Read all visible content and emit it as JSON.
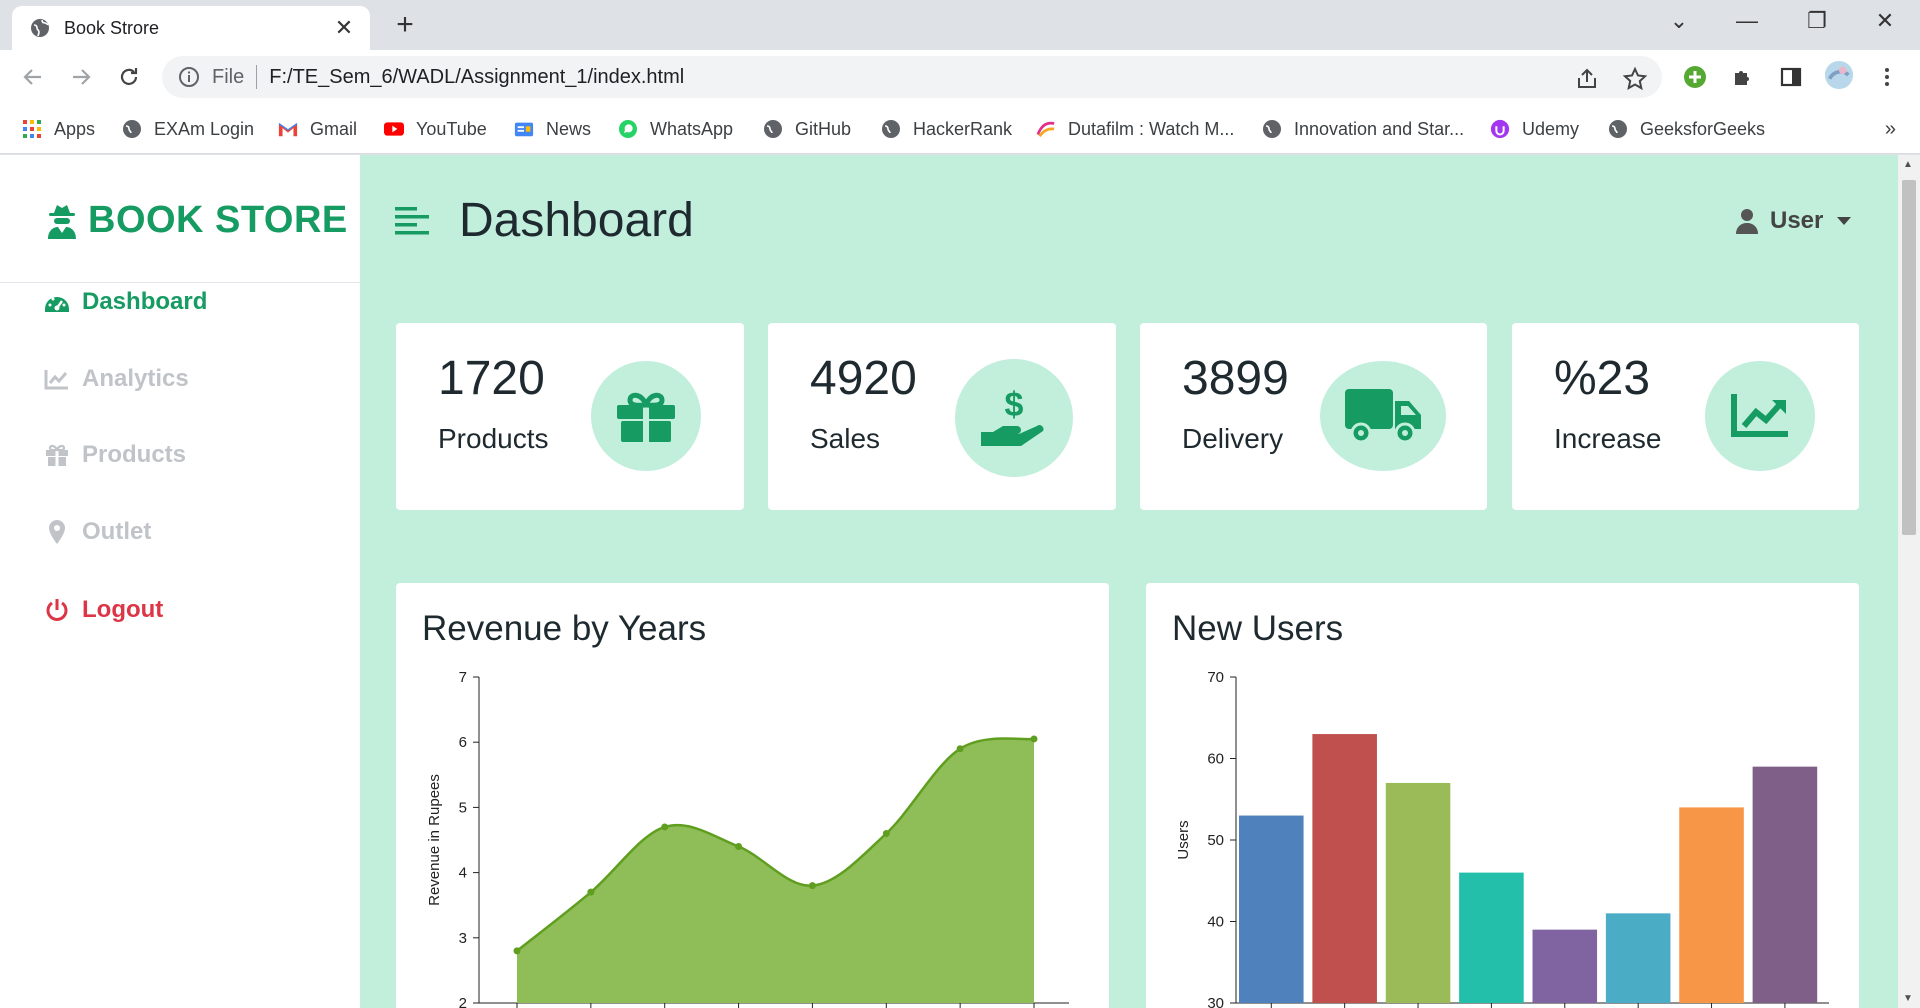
{
  "browser": {
    "tab_title": "Book Strore",
    "address_scheme": "File",
    "address_url": "F:/TE_Sem_6/WADL/Assignment_1/index.html",
    "bookmarks": [
      {
        "label": "Apps",
        "icon": "apps-grid-icon"
      },
      {
        "label": "EXAm Login",
        "icon": "globe-icon"
      },
      {
        "label": "Gmail",
        "icon": "gmail-icon"
      },
      {
        "label": "YouTube",
        "icon": "youtube-icon"
      },
      {
        "label": "News",
        "icon": "google-news-icon"
      },
      {
        "label": "WhatsApp",
        "icon": "whatsapp-icon"
      },
      {
        "label": "GitHub",
        "icon": "globe-icon"
      },
      {
        "label": "HackerRank",
        "icon": "globe-icon"
      },
      {
        "label": "Dutafilm : Watch M...",
        "icon": "dutafilm-icon"
      },
      {
        "label": "Innovation and Star...",
        "icon": "globe-icon"
      },
      {
        "label": "Udemy",
        "icon": "udemy-icon"
      },
      {
        "label": "GeeksforGeeks",
        "icon": "globe-icon"
      }
    ],
    "bookmarks_more": "»"
  },
  "sidebar": {
    "brand": "BOOK STORE",
    "brand_icon": "user-secret-icon",
    "items": [
      {
        "label": "Dashboard",
        "icon": "tachometer-icon",
        "state": "active"
      },
      {
        "label": "Analytics",
        "icon": "line-chart-icon",
        "state": "muted"
      },
      {
        "label": "Products",
        "icon": "gift-icon",
        "state": "muted"
      },
      {
        "label": "Outlet",
        "icon": "map-marker-icon",
        "state": "muted"
      },
      {
        "label": "Logout",
        "icon": "power-icon",
        "state": "danger"
      }
    ]
  },
  "header": {
    "title": "Dashboard",
    "user_label": "User"
  },
  "stats": [
    {
      "value": "1720",
      "label": "Products",
      "icon": "gift-icon"
    },
    {
      "value": "4920",
      "label": "Sales",
      "icon": "hand-holding-dollar-icon"
    },
    {
      "value": "3899",
      "label": "Delivery",
      "icon": "truck-icon"
    },
    {
      "value": "%23",
      "label": "Increase",
      "icon": "chart-line-icon"
    }
  ],
  "colors": {
    "accent": "#169b62",
    "page_bg": "#c2eedc",
    "danger": "#dc3545",
    "muted": "#c0c4c8"
  },
  "charts": {
    "revenue_title": "Revenue by Years",
    "users_title": "New Users"
  },
  "chart_data": [
    {
      "type": "area",
      "title": "Revenue by Years",
      "xlabel": "",
      "ylabel": "Revenue in Rupees",
      "ylim": [
        2,
        7
      ],
      "yticks": [
        "2",
        "3",
        "4",
        "5",
        "6",
        "7"
      ],
      "y": [
        2.8,
        3.7,
        4.7,
        4.4,
        3.8,
        4.6,
        5.9,
        6.05
      ],
      "color": "#8fbd58",
      "line_color": "#5f9e1f",
      "grid": false
    },
    {
      "type": "bar",
      "title": "New Users",
      "xlabel": "",
      "ylabel": "Users",
      "ylim": [
        30,
        70
      ],
      "yticks": [
        "30",
        "40",
        "50",
        "60",
        "70"
      ],
      "values": [
        53,
        63,
        57,
        46,
        39,
        41,
        54,
        59
      ],
      "colors": [
        "#4f81bd",
        "#c0504d",
        "#9bbb59",
        "#23bfaa",
        "#8064a2",
        "#4bacc6",
        "#f79646",
        "#7f5f87"
      ],
      "grid": false
    }
  ]
}
